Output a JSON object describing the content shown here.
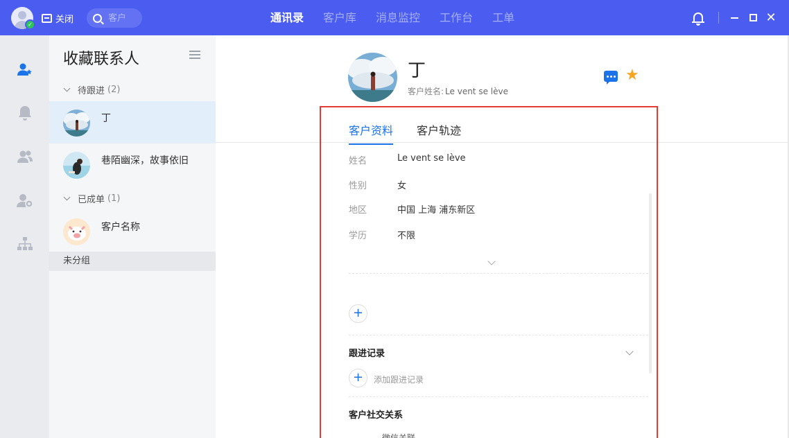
{
  "topbar": {
    "close_label": "关闭",
    "search_placeholder": "客户",
    "nav": [
      "通讯录",
      "客户库",
      "消息监控",
      "工作台",
      "工单"
    ],
    "active_nav": "通讯录",
    "color": "#4b5cf0"
  },
  "list": {
    "title": "收藏联系人",
    "groups": [
      {
        "label": "待跟进",
        "count": "(2)"
      },
      {
        "label": "已成单",
        "count": "(1)"
      }
    ],
    "contacts": [
      {
        "name": "丁",
        "selected": true
      },
      {
        "name": "巷陌幽深，故事依旧",
        "selected": false
      },
      {
        "name": "客户名称",
        "selected": false
      }
    ],
    "ungrouped_label": "未分组"
  },
  "detail": {
    "name": "丁",
    "sub_label": "客户姓名:",
    "sub_value": "Le vent se lève",
    "tabs": [
      "客户资料",
      "客户轨迹"
    ],
    "active_tab": "客户资料",
    "fields": [
      {
        "label": "姓名",
        "value": "Le vent se lève"
      },
      {
        "label": "性别",
        "value": "女"
      },
      {
        "label": "地区",
        "value": "中国 上海 浦东新区"
      },
      {
        "label": "学历",
        "value": "不限"
      }
    ],
    "follow_section": "跟进记录",
    "add_follow": "添加跟进记录",
    "social_section": "客户社交关系",
    "truncated_text": "微信关联"
  },
  "colors": {
    "accent": "#1a73e8",
    "highlight": "#e53935",
    "star": "#f5a623"
  }
}
